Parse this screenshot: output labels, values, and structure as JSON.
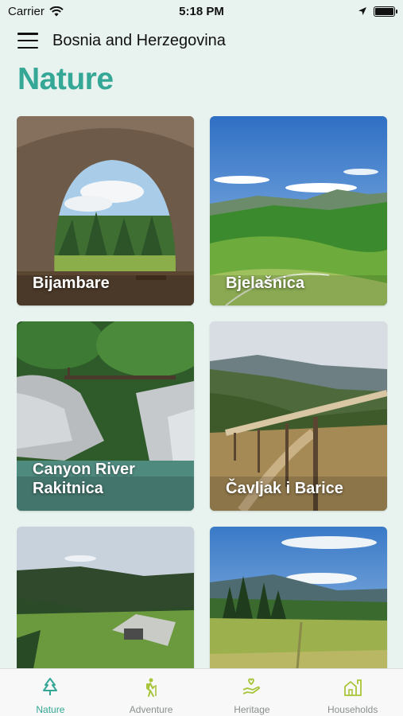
{
  "status": {
    "carrier": "Carrier",
    "time": "5:18 PM"
  },
  "header": {
    "title": "Bosnia and Herzegovina"
  },
  "page": {
    "title": "Nature"
  },
  "cards": [
    {
      "label": "Bijambare"
    },
    {
      "label": "Bjelašnica"
    },
    {
      "label": "Canyon River Rakitnica"
    },
    {
      "label": "Čavljak i Barice"
    },
    {
      "label": ""
    },
    {
      "label": ""
    }
  ],
  "tabs": [
    {
      "label": "Nature",
      "active": true
    },
    {
      "label": "Adventure"
    },
    {
      "label": "Heritage"
    },
    {
      "label": "Households"
    }
  ],
  "colors": {
    "accent": "#35a796",
    "icon_inactive": "#a8c53a",
    "background": "#e8f2ef"
  }
}
